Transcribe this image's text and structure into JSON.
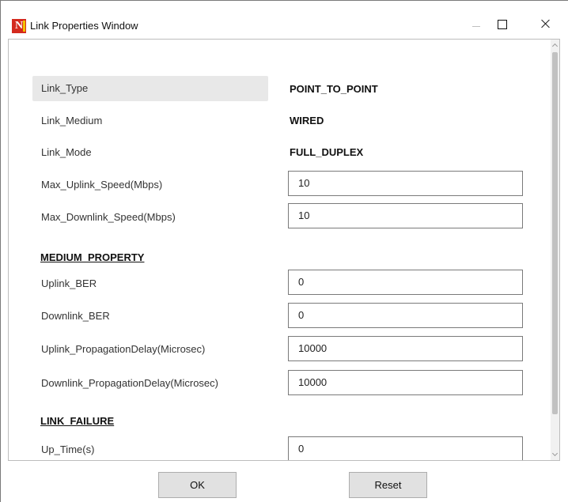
{
  "window": {
    "title": "Link Properties Window",
    "icon": "netsim-app-icon",
    "controls": [
      "minimize-icon",
      "maximize-icon",
      "close-icon"
    ]
  },
  "properties": [
    {
      "label": "Link_Type",
      "value": "POINT_TO_POINT",
      "kind": "readonly",
      "selected": true
    },
    {
      "label": "Link_Medium",
      "value": "WIRED",
      "kind": "readonly"
    },
    {
      "label": "Link_Mode",
      "value": "FULL_DUPLEX",
      "kind": "readonly"
    },
    {
      "label": "Max_Uplink_Speed(Mbps)",
      "value": "10",
      "kind": "input"
    },
    {
      "label": "Max_Downlink_Speed(Mbps)",
      "value": "10",
      "kind": "input"
    }
  ],
  "medium_property": {
    "header": "MEDIUM_PROPERTY",
    "fields": [
      {
        "label": "Uplink_BER",
        "value": "0"
      },
      {
        "label": "Downlink_BER",
        "value": "0"
      },
      {
        "label": "Uplink_PropagationDelay(Microsec)",
        "value": "10000"
      },
      {
        "label": "Downlink_PropagationDelay(Microsec)",
        "value": "10000"
      }
    ]
  },
  "link_failure": {
    "header": "LINK_FAILURE",
    "fields": [
      {
        "label": "Up_Time(s)",
        "value": "0"
      }
    ]
  },
  "buttons": {
    "ok": "OK",
    "reset": "Reset"
  }
}
